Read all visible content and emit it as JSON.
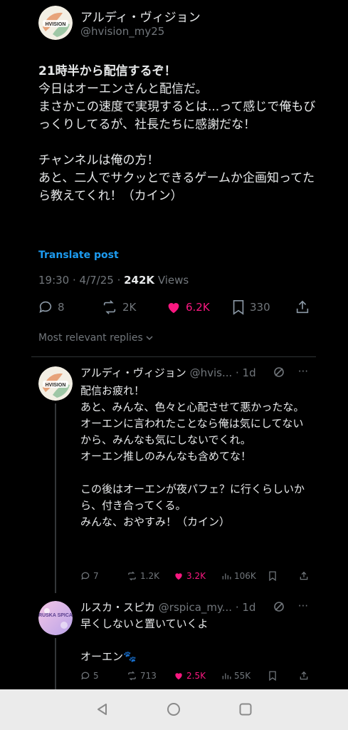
{
  "tweet": {
    "author_name": "アルディ・ヴィジョン",
    "author_handle": "@hvision_my25",
    "text_lead": "21時半から配信するぞ！",
    "text_rest": "今日はオーエンさんと配信だ。\nまさかこの速度で実現するとは...って感じで俺もびっくりしてるが、社長たちに感謝だな！\n\nチャンネルは俺の方！\nあと、二人でサクッとできるゲームか企画知ってたら教えてくれ！（カイン）",
    "translate_label": "Translate post",
    "timestamp": "19:30 · 4/7/25 · ",
    "views_count": "242K",
    "views_label": " Views",
    "replies": "8",
    "reposts": "2K",
    "likes": "6.2K",
    "bookmarks": "330"
  },
  "sort": {
    "label": "Most relevant replies"
  },
  "replies": [
    {
      "name": "アルディ・ヴィジョン",
      "handle": " @hvis... · 1d",
      "text": "配信お疲れ！\nあと、みんな、色々と心配させて悪かったな。\nオーエンに言われたことなら俺は気にしてないから、みんなも気にしないでくれ。\nオーエン推しのみんなも含めてな！\n\nこの後はオーエンが夜パフェ？に行くらしいから、付き合ってくる。\nみんな、おやすみ！（カイン）",
      "replies": "7",
      "reposts": "1.2K",
      "likes": "3.2K",
      "views": "106K"
    },
    {
      "name": "ルスカ・スピカ",
      "handle": " @rspica_my... · 1d",
      "text": "早くしないと置いていくよ\n\nオーエン🐾",
      "replies": "5",
      "reposts": "713",
      "likes": "2.5K",
      "views": "55K"
    }
  ],
  "avatars": {
    "main_text": "HVISION",
    "reply2_text": "RUSKA SPICA"
  },
  "colors": {
    "accent": "#1d9bf0",
    "like": "#f91880",
    "muted": "#71767b"
  }
}
